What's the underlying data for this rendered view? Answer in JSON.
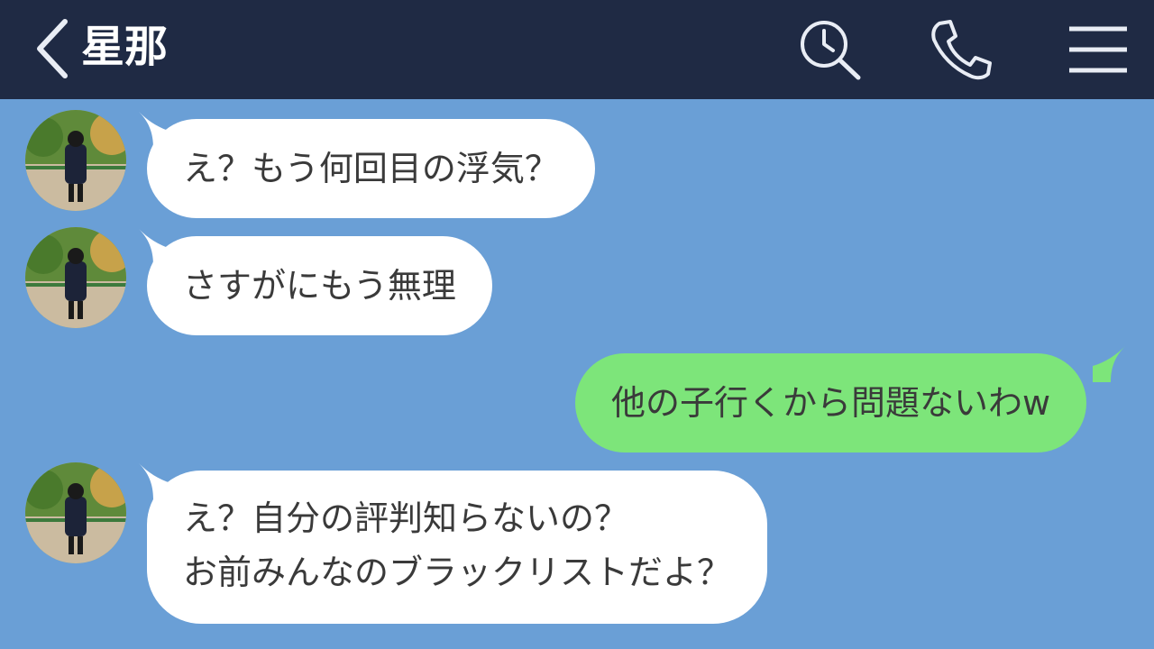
{
  "header": {
    "title": "星那",
    "colors": {
      "bar": "#1f2a44",
      "icon": "#e9edf5"
    },
    "icons": [
      "back-chevron-icon",
      "search-history-icon",
      "phone-icon",
      "menu-icon"
    ]
  },
  "chat": {
    "background": "#6a9fd6",
    "messages": [
      {
        "side": "left",
        "lines": [
          "え？もう何回目の浮気？"
        ]
      },
      {
        "side": "left",
        "lines": [
          "さすがにもう無理"
        ]
      },
      {
        "side": "right",
        "lines": [
          "他の子行くから問題ないわw"
        ]
      },
      {
        "side": "left",
        "lines": [
          "え？自分の評判知らないの？",
          "お前みんなのブラックリストだよ？"
        ]
      }
    ],
    "bubble_colors": {
      "incoming": "#ffffff",
      "outgoing": "#7de57a"
    }
  }
}
